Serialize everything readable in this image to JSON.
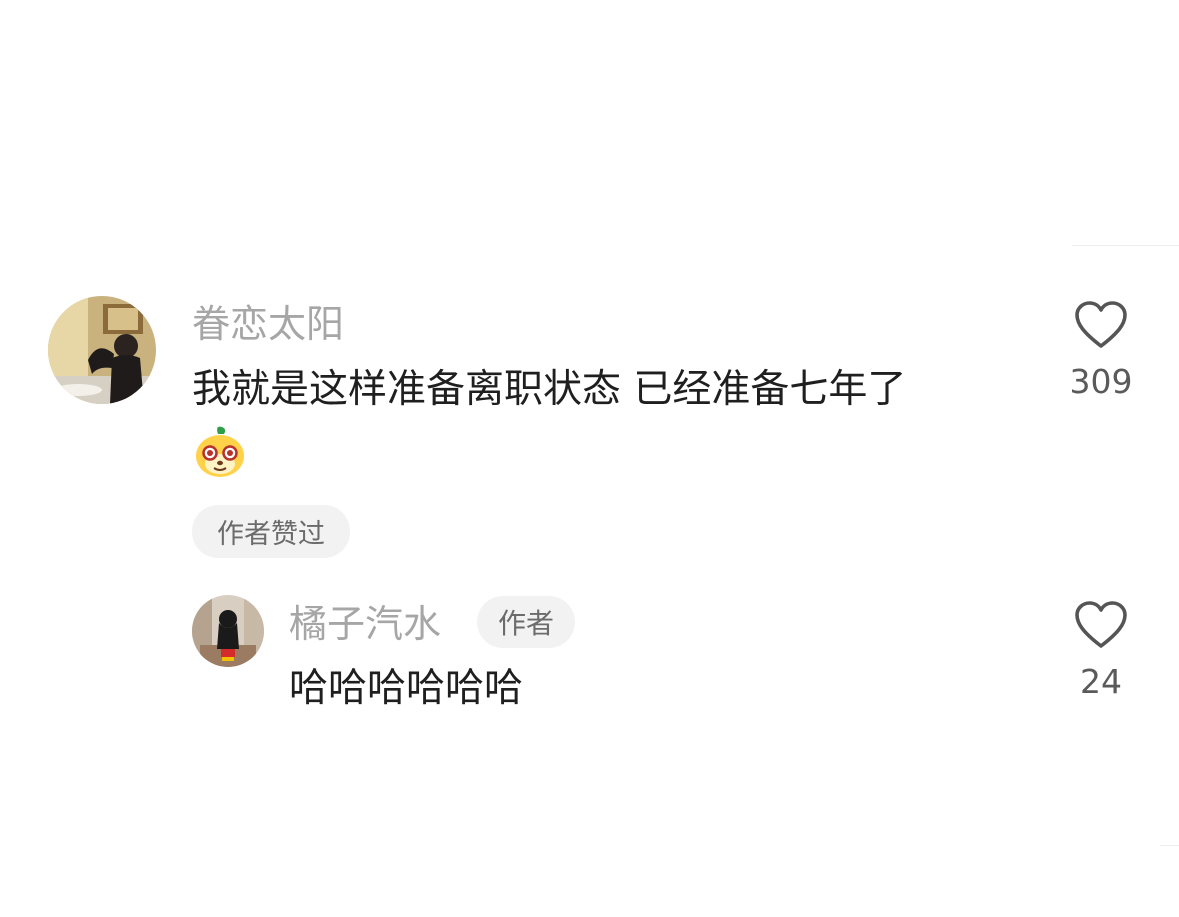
{
  "comments": [
    {
      "username": "眷恋太阳",
      "text": "我就是这样准备离职状态 已经准备七年了",
      "emoji": "cute-yellow-face-emoji",
      "author_liked_tag": "作者赞过",
      "like_count": "309",
      "replies": [
        {
          "username": "橘子汽水",
          "badge": "作者",
          "text": "哈哈哈哈哈哈",
          "like_count": "24"
        }
      ]
    }
  ],
  "icons": {
    "like": "heart-outline-icon"
  },
  "colors": {
    "username": "#a6a6a6",
    "text": "#1f1f1f",
    "pill_bg": "#f2f2f2",
    "count": "#5a5a5a"
  }
}
